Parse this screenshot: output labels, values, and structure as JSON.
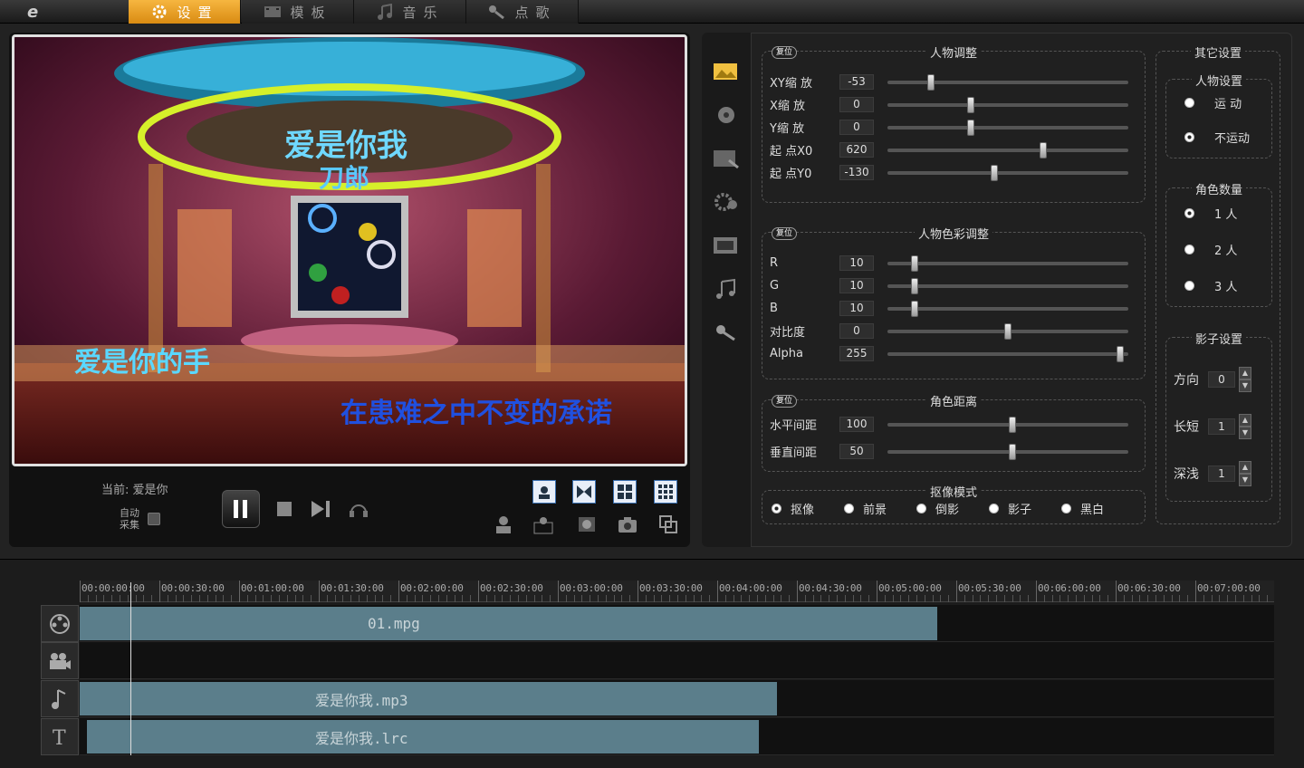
{
  "tabs": [
    {
      "label": "设置",
      "icon": "gear-icon",
      "active": true
    },
    {
      "label": "模板",
      "icon": "film-icon"
    },
    {
      "label": "音乐",
      "icon": "music-icon"
    },
    {
      "label": "点歌",
      "icon": "microphone-icon"
    }
  ],
  "preview": {
    "lyrics": {
      "title": "爱是你我",
      "artist": "刀郎",
      "line1": "爱是你的手",
      "line2": "在患难之中不变的承诺"
    }
  },
  "player": {
    "current_label": "当前: 爱是你",
    "auto_capture": "自动采集"
  },
  "person_adjust": {
    "title": "人物调整",
    "reset": "复位",
    "rows": [
      {
        "label": "XY缩  放",
        "value": "-53",
        "pos": 0.17
      },
      {
        "label": "X缩  放",
        "value": "0",
        "pos": 0.34
      },
      {
        "label": "Y缩  放",
        "value": "0",
        "pos": 0.34
      },
      {
        "label": "起  点X0",
        "value": "620",
        "pos": 0.65
      },
      {
        "label": "起  点Y0",
        "value": "-130",
        "pos": 0.44
      }
    ]
  },
  "color_adjust": {
    "title": "人物色彩调整",
    "reset": "复位",
    "rows": [
      {
        "label": "R",
        "value": "10",
        "pos": 0.1
      },
      {
        "label": "G",
        "value": "10",
        "pos": 0.1
      },
      {
        "label": "B",
        "value": "10",
        "pos": 0.1
      },
      {
        "label": "对比度",
        "value": "0",
        "pos": 0.5
      },
      {
        "label": "Alpha",
        "value": "255",
        "pos": 0.98
      }
    ]
  },
  "role_distance": {
    "title": "角色距离",
    "reset": "复位",
    "rows": [
      {
        "label": "水平间距",
        "value": "100",
        "pos": 0.52
      },
      {
        "label": "垂直间距",
        "value": "50",
        "pos": 0.52
      }
    ]
  },
  "capture_mode": {
    "title": "抠像模式",
    "options": [
      "抠像",
      "前景",
      "倒影",
      "影子",
      "黑白"
    ],
    "selected": 0
  },
  "other": {
    "title": "其它设置",
    "person": {
      "title": "人物设置",
      "options": [
        "运  动",
        "不运动"
      ],
      "selected": 1
    },
    "count": {
      "title": "角色数量",
      "options": [
        "1  人",
        "2  人",
        "3  人"
      ],
      "selected": 0
    },
    "shadow": {
      "title": "影子设置",
      "rows": [
        {
          "label": "方向",
          "value": "0"
        },
        {
          "label": "长短",
          "value": "1"
        },
        {
          "label": "深浅",
          "value": "1"
        }
      ]
    }
  },
  "timeline": {
    "ticks": [
      "00:00:00:00",
      "00:00:30:00",
      "00:01:00:00",
      "00:01:30:00",
      "00:02:00:00",
      "00:02:30:00",
      "00:03:00:00",
      "00:03:30:00",
      "00:04:00:00",
      "00:04:30:00",
      "00:05:00:00",
      "00:05:30:00",
      "00:06:00:00",
      "00:06:30:00",
      "00:07:00:00"
    ],
    "clips": [
      {
        "track": 0,
        "name": "01.mpg"
      },
      {
        "track": 2,
        "name": "爱是你我.mp3"
      },
      {
        "track": 3,
        "name": "爱是你我.lrc"
      }
    ]
  }
}
